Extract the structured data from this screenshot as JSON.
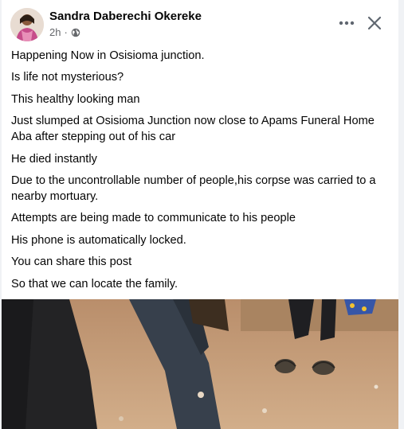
{
  "post": {
    "author": "Sandra Daberechi Okereke",
    "time": "2h",
    "separator": "·",
    "visibility_icon": "globe-icon",
    "paragraphs": [
      "Happening Now in Osisioma junction.",
      "Is life not mysterious?",
      "This healthy looking man",
      "Just slumped at Osisioma Junction now close to Apams Funeral Home Aba after stepping out of his car",
      "He died instantly",
      "Due to the uncontrollable number of people,his corpse was carried to a nearby mortuary.",
      "Attempts are being made to communicate to his people",
      "His phone is automatically locked.",
      "You can share this post",
      "So that we can locate the family."
    ]
  },
  "actions": {
    "more_icon": "more-horizontal-icon",
    "close_icon": "close-icon"
  },
  "colors": {
    "text_primary": "#050505",
    "text_secondary": "#65676b",
    "card_background": "#ffffff",
    "page_background": "#f0f2f5"
  }
}
